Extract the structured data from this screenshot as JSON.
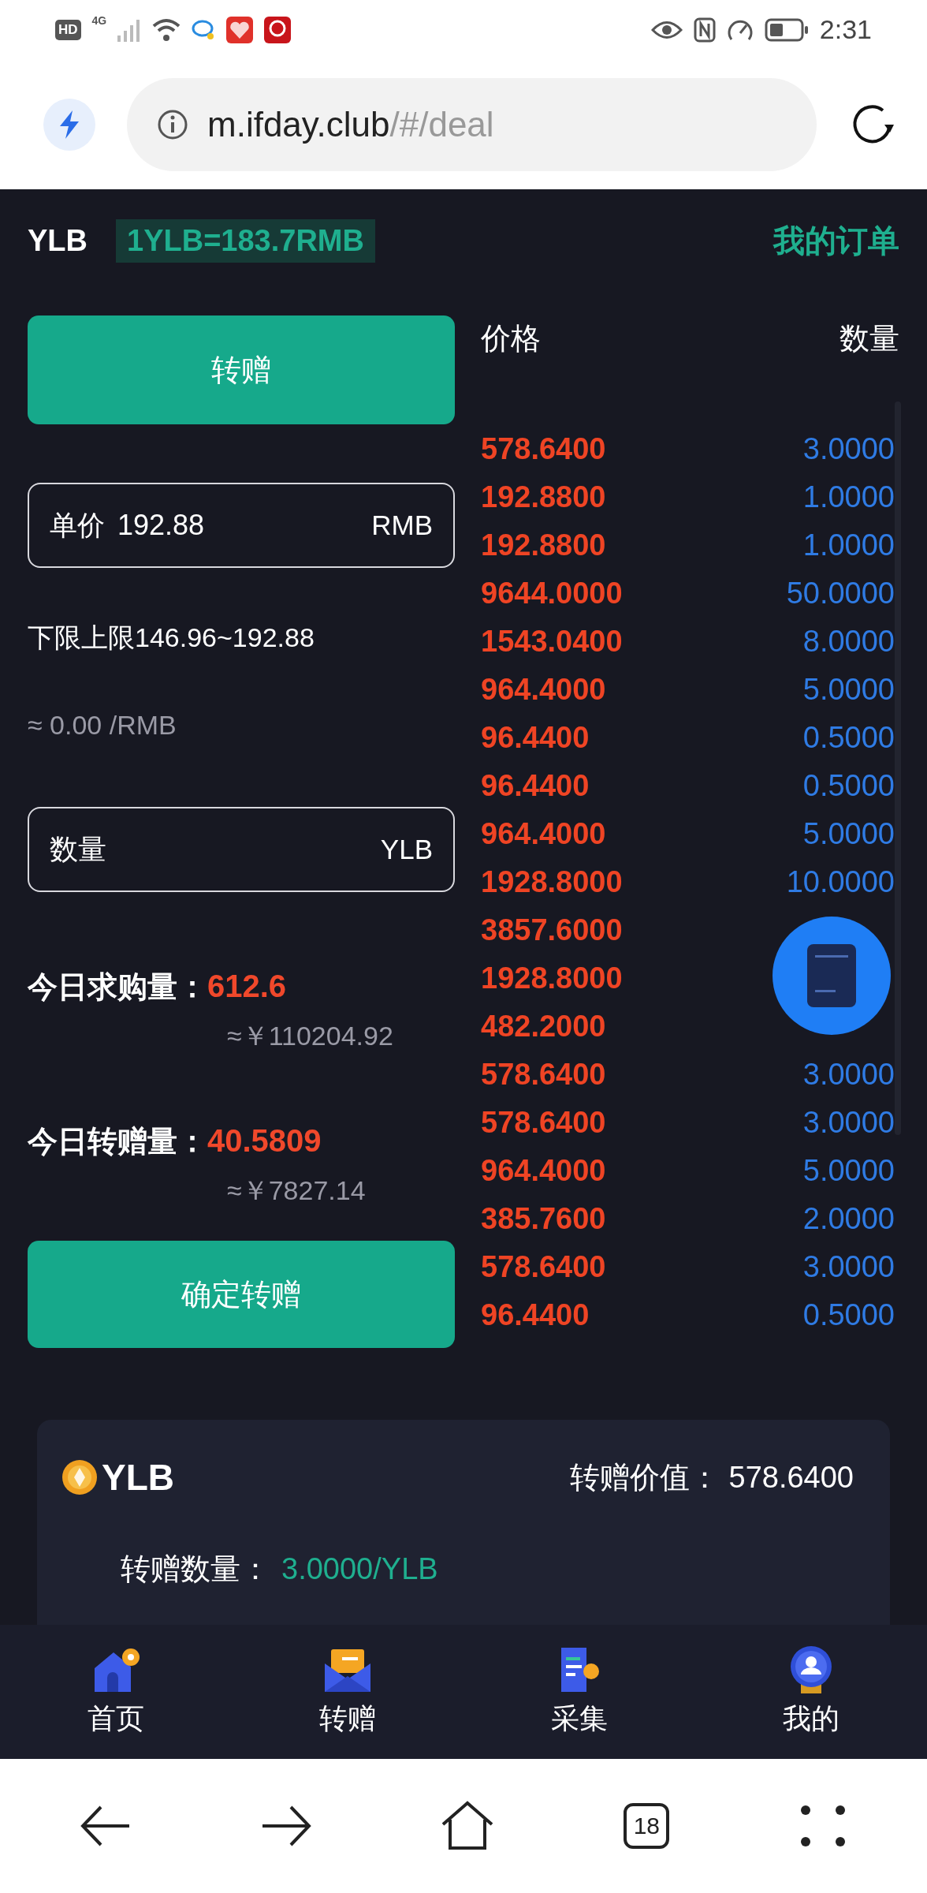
{
  "status_bar": {
    "network_badge": "HD",
    "network_type": "4G",
    "time": "2:31"
  },
  "browser": {
    "url_host": "m.ifday.club",
    "url_path": "/#/deal",
    "tab_count": "18"
  },
  "header": {
    "coin": "YLB",
    "rate": "1YLB=183.7RMB",
    "orders_link": "我的订单"
  },
  "form": {
    "mode_button": "转赠",
    "price_field": {
      "label": "单价",
      "value": "192.88",
      "unit": "RMB"
    },
    "limits": "下限上限146.96~192.88",
    "estimate": "≈ 0.00 /RMB",
    "quantity_field": {
      "placeholder": "数量",
      "unit": "YLB"
    },
    "stats": [
      {
        "label": "今日求购量：",
        "value": "612.6",
        "approx": "≈￥110204.92"
      },
      {
        "label": "今日转赠量：",
        "value": "40.5809",
        "approx": "≈￥7827.14"
      }
    ],
    "confirm_button": "确定转赠"
  },
  "order_book": {
    "columns": [
      "价格",
      "数量"
    ],
    "rows": [
      {
        "price": "578.6400",
        "quantity": "3.0000"
      },
      {
        "price": "192.8800",
        "quantity": "1.0000"
      },
      {
        "price": "192.8800",
        "quantity": "1.0000"
      },
      {
        "price": "9644.0000",
        "quantity": "50.0000"
      },
      {
        "price": "1543.0400",
        "quantity": "8.0000"
      },
      {
        "price": "964.4000",
        "quantity": "5.0000"
      },
      {
        "price": "96.4400",
        "quantity": "0.5000"
      },
      {
        "price": "96.4400",
        "quantity": "0.5000"
      },
      {
        "price": "964.4000",
        "quantity": "5.0000"
      },
      {
        "price": "1928.8000",
        "quantity": "10.0000"
      },
      {
        "price": "3857.6000"
      },
      {
        "price": "1928.8000"
      },
      {
        "price": "482.2000"
      },
      {
        "price": "578.6400",
        "quantity": "3.0000"
      },
      {
        "price": "578.6400",
        "quantity": "3.0000"
      },
      {
        "price": "964.4000",
        "quantity": "5.0000"
      },
      {
        "price": "385.7600",
        "quantity": "2.0000"
      },
      {
        "price": "578.6400",
        "quantity": "3.0000"
      },
      {
        "price": "96.4400",
        "quantity": "0.5000"
      }
    ]
  },
  "listing": {
    "coin": "YLB",
    "value_label": "转赠价值：",
    "value": "578.6400",
    "fields": [
      {
        "label": "转赠数量：",
        "value": "3.0000/YLB"
      }
    ]
  },
  "tab_bar": [
    {
      "label": "首页",
      "kind": "home"
    },
    {
      "label": "转赠",
      "kind": "gift"
    },
    {
      "label": "采集",
      "kind": "collect"
    },
    {
      "label": "我的",
      "kind": "profile"
    }
  ]
}
